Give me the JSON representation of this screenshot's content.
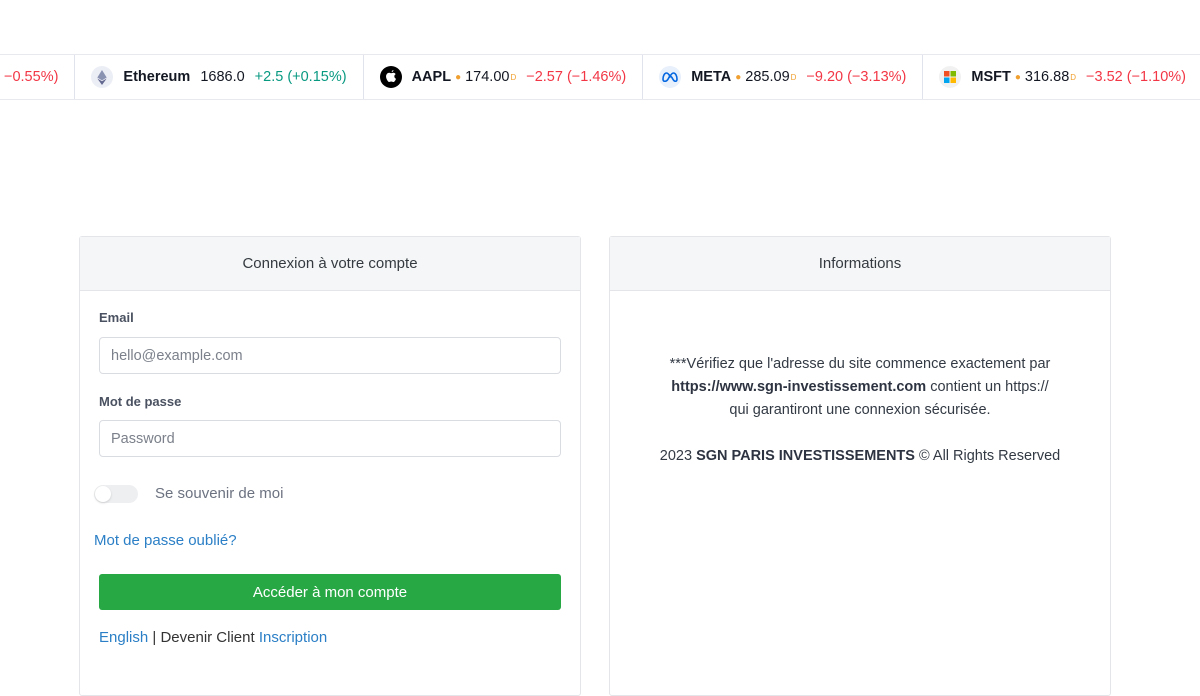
{
  "ticker": [
    {
      "symbol": "",
      "price": "",
      "change": "−0.55%)",
      "direction": "neg",
      "logo": "none",
      "partial": true
    },
    {
      "symbol": "Ethereum",
      "price": "1686.0",
      "change": "+2.5 (+0.15%)",
      "direction": "pos",
      "logo": "ethereum-icon"
    },
    {
      "symbol": "AAPL",
      "price": "174.00",
      "delayed": "D",
      "change": "−2.57 (−1.46%)",
      "direction": "neg",
      "logo": "apple-icon"
    },
    {
      "symbol": "META",
      "price": "285.09",
      "delayed": "D",
      "change": "−9.20 (−3.13%)",
      "direction": "neg",
      "logo": "meta-icon"
    },
    {
      "symbol": "MSFT",
      "price": "316.88",
      "delayed": "D",
      "change": "−3.52 (−1.10%)",
      "direction": "neg",
      "logo": "microsoft-icon"
    }
  ],
  "login": {
    "title": "Connexion à votre compte",
    "email_label": "Email",
    "email_placeholder": "hello@example.com",
    "password_label": "Mot de passe",
    "password_placeholder": "Password",
    "remember_label": "Se souvenir de moi",
    "forgot_link": "Mot de passe oublié?",
    "submit_label": "Accéder à mon compte",
    "footer": {
      "english_link": "English",
      "separator": "|",
      "become_client": "Devenir Client",
      "signup_link": "Inscription"
    }
  },
  "info": {
    "title": "Informations",
    "line1": "***Vérifiez que l'adresse du site commence exactement par",
    "site_url": "https://www.sgn-investissement.com",
    "line2_rest": "contient un https://",
    "line3": "qui garantiront une connexion sécurisée.",
    "copyright_year": "2023",
    "company": "SGN PARIS INVESTISSEMENTS",
    "copyright_rest": "© All Rights Reserved"
  },
  "colors": {
    "positive": "#089981",
    "negative": "#f23645",
    "submit_button": "#28a745",
    "link": "#2b7fc6"
  }
}
